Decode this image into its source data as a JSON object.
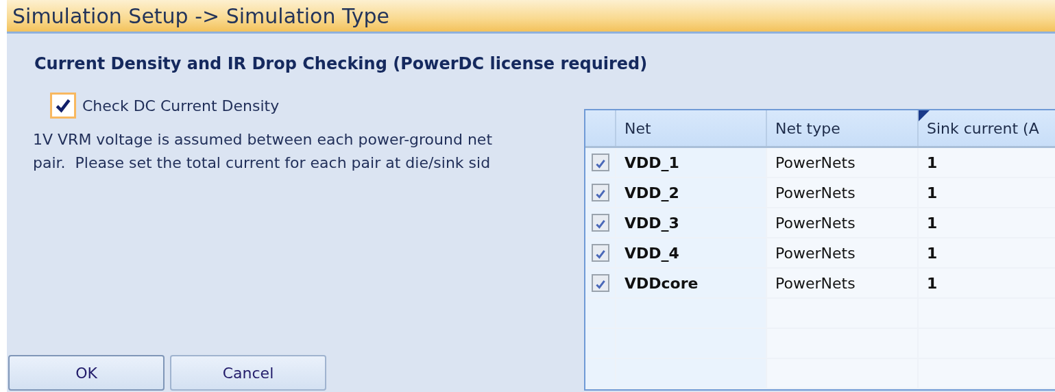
{
  "window": {
    "title": "Simulation Setup -> Simulation Type"
  },
  "section": {
    "heading": "Current Density and IR Drop Checking (PowerDC license required)"
  },
  "option": {
    "label": "Check DC Current Density",
    "checked": true
  },
  "description_lines": [
    "1V VRM voltage is assumed between each power-ground net",
    "pair.  Please set the total current for each pair at die/sink sid"
  ],
  "table": {
    "columns": [
      "Net",
      "Net type",
      "Sink current (A"
    ],
    "rows": [
      {
        "checked": true,
        "net": "VDD_1",
        "net_type": "PowerNets",
        "sink_current": "1"
      },
      {
        "checked": true,
        "net": "VDD_2",
        "net_type": "PowerNets",
        "sink_current": "1"
      },
      {
        "checked": true,
        "net": "VDD_3",
        "net_type": "PowerNets",
        "sink_current": "1"
      },
      {
        "checked": true,
        "net": "VDD_4",
        "net_type": "PowerNets",
        "sink_current": "1"
      },
      {
        "checked": true,
        "net": "VDDcore",
        "net_type": "PowerNets",
        "sink_current": "1"
      }
    ]
  },
  "buttons": [
    "OK",
    "Cancel"
  ]
}
